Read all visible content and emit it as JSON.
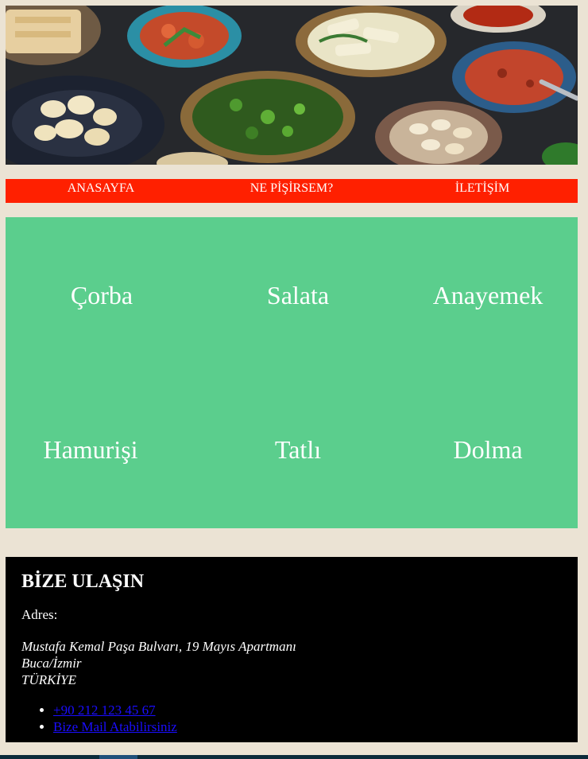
{
  "hero": {
    "image_name": "turkish-food-spread-image"
  },
  "nav": {
    "items": [
      "ANASAYFA",
      "NE PİŞİRSEM?",
      "İLETİŞİM"
    ]
  },
  "categories": {
    "items": [
      "Çorba",
      "Salata",
      "Anayemek",
      "Hamurişi",
      "Tatlı",
      "Dolma"
    ]
  },
  "contact": {
    "title": "BİZE ULAŞIN",
    "address_label": "Adres:",
    "address_lines": [
      "Mustafa Kemal Paşa Bulvarı, 19 Mayıs Apartmanı",
      "Buca/İzmir",
      "TÜRKİYE"
    ],
    "links": [
      "+90 212 123 45 67",
      "Bize Mail Atabilirsiniz"
    ]
  },
  "colors": {
    "page_background": "#ebe3d4",
    "nav_background": "#ff2000",
    "categories_background": "#5bce8d",
    "contact_background": "#000000",
    "link_color": "#1a0dff"
  }
}
